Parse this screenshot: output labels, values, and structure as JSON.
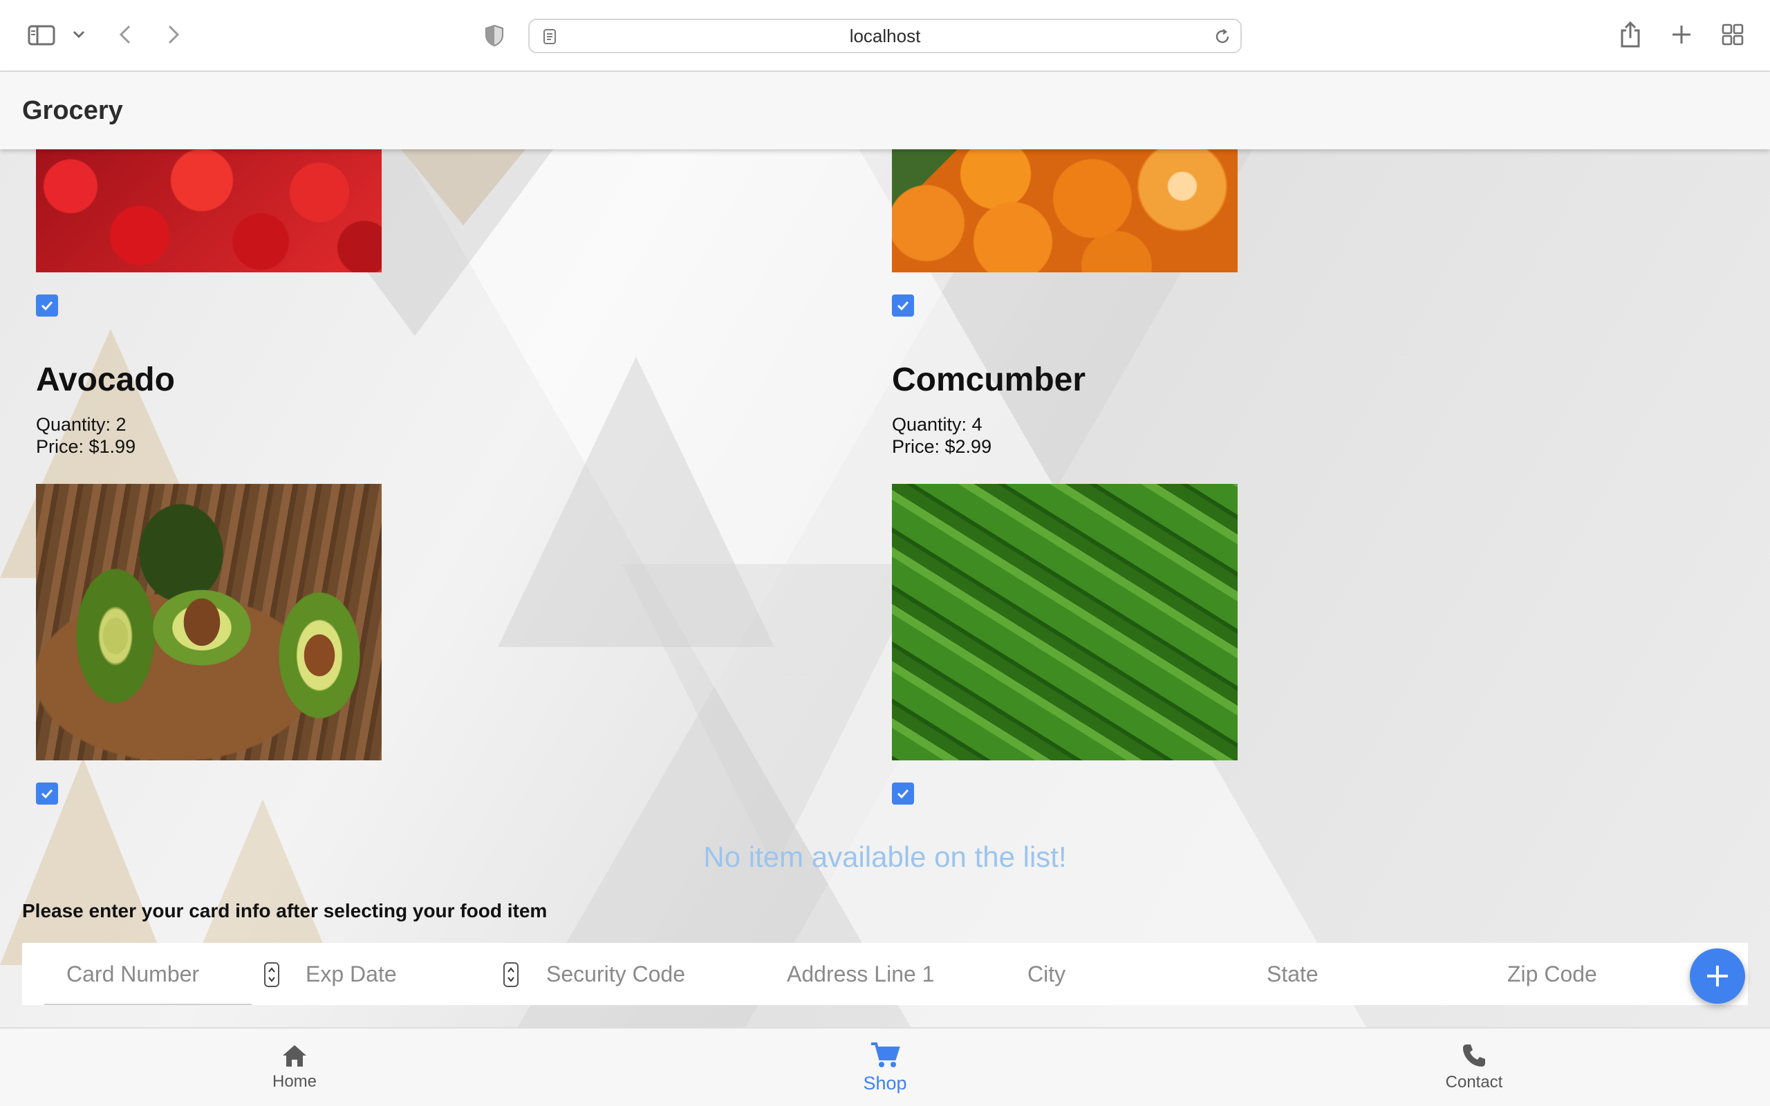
{
  "browser": {
    "url": "localhost"
  },
  "app": {
    "title": "Grocery"
  },
  "items": [
    {
      "name": "",
      "quantity": "",
      "price": "",
      "image": "tomatoes-photo",
      "checked": true
    },
    {
      "name": "",
      "quantity": "",
      "price": "",
      "image": "oranges-photo",
      "checked": true
    },
    {
      "name": "Avocado",
      "quantity": "Quantity: 2",
      "price": "Price: $1.99",
      "image": "avocado-photo",
      "checked": true
    },
    {
      "name": "Comcumber",
      "quantity": "Quantity: 4",
      "price": "Price: $2.99",
      "image": "cucumber-photo",
      "checked": true
    }
  ],
  "empty_message": "No item available on the list!",
  "payment": {
    "hint": "Please enter your card info after selecting your food item",
    "fields": {
      "card_number": "Card Number",
      "exp_date": "Exp Date",
      "security_code": "Security Code",
      "address_line_1": "Address Line 1",
      "city": "City",
      "state": "State",
      "zip_code": "Zip Code"
    }
  },
  "nav": {
    "home": "Home",
    "shop": "Shop",
    "contact": "Contact"
  },
  "colors": {
    "accent": "#3f82ef",
    "empty_text": "#9cc4ee"
  }
}
